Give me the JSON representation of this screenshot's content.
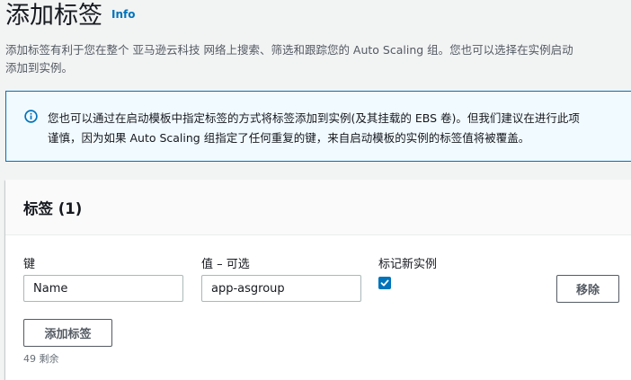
{
  "header": {
    "title": "添加标签",
    "info_link": "Info"
  },
  "description": {
    "line1": "添加标签有利于您在整个 亚马逊云科技 网络上搜索、筛选和跟踪您的 Auto Scaling 组。您也可以选择在实例启动",
    "line2": "添加到实例。"
  },
  "alert": {
    "icon": "info-circle-icon",
    "line1": "您也可以通过在启动模板中指定标签的方式将标签添加到实例(及其挂载的 EBS 卷)。但我们建议在进行此项",
    "line2": "谨慎，因为如果 Auto Scaling 组指定了任何重复的键，来自启动模板的实例的标签值将被覆盖。"
  },
  "tags_panel": {
    "title": "标签 (1)",
    "columns": {
      "key": "键",
      "value": "值 – 可选",
      "tag_new_instances": "标记新实例"
    },
    "rows": [
      {
        "key": "Name",
        "value": "app-asgroup",
        "tag_new_instances": true,
        "remove_label": "移除"
      }
    ],
    "add_button_label": "添加标签",
    "remaining_text": "49 剩余"
  },
  "colors": {
    "accent": "#0073bb",
    "alert_background": "#f1faff",
    "page_background": "#f2f3f3"
  }
}
